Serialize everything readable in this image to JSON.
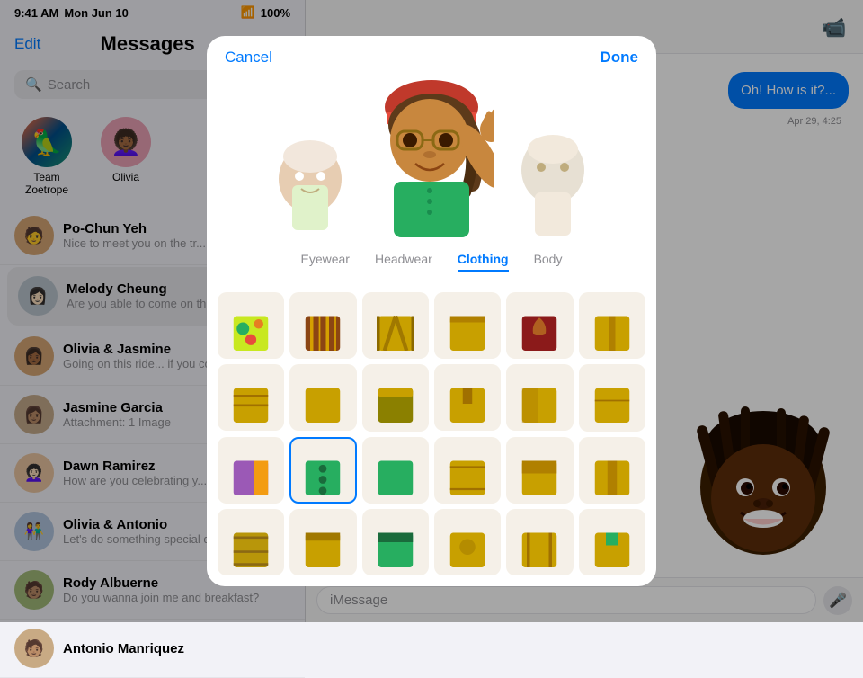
{
  "statusBar": {
    "time": "9:41 AM",
    "date": "Mon Jun 10",
    "wifi": "WiFi",
    "battery": "100%"
  },
  "sidebar": {
    "title": "Messages",
    "editLabel": "Edit",
    "searchPlaceholder": "Search",
    "pinnedItems": [
      {
        "id": "team-zoetrope",
        "label": "Team Zoetrope",
        "emoji": "🦜"
      },
      {
        "id": "olivia",
        "label": "Olivia",
        "emoji": "👩🏾‍🦱"
      }
    ],
    "conversations": [
      {
        "id": "po-chun",
        "name": "Po-Chun Yeh",
        "preview": "Nice to meet you on the tr...",
        "emoji": "🧑"
      },
      {
        "id": "melody",
        "name": "Melody Cheung",
        "preview": "Are you able to come on th ride or not?",
        "emoji": "👩🏻",
        "active": true
      },
      {
        "id": "olivia-jasmine",
        "name": "Olivia & Jasmine",
        "preview": "Going on this ride... if you come too you're welcome",
        "emoji": "👩🏾"
      },
      {
        "id": "jasmine-garcia",
        "name": "Jasmine Garcia",
        "preview": "Attachment: 1 Image",
        "emoji": "👩🏽"
      },
      {
        "id": "dawn-ramirez",
        "name": "Dawn Ramirez",
        "preview": "How are you celebrating y... big day?",
        "emoji": "👩🏻‍🦱"
      },
      {
        "id": "olivia-antonio",
        "name": "Olivia & Antonio",
        "preview": "Let's do something special dawn at the next meeting r...",
        "emoji": "👫"
      },
      {
        "id": "rody-albuerne",
        "name": "Rody Albuerne",
        "preview": "Do you wanna join me and breakfast?",
        "emoji": "🧑🏽"
      },
      {
        "id": "antonio-manriquez",
        "name": "Antonio Manriquez",
        "preview": "",
        "emoji": "🧑🏽"
      }
    ]
  },
  "chat": {
    "bubbles": [
      {
        "text": "Oh! How is it?..."
      },
      {
        "text": "Apr 29, 4:25"
      }
    ],
    "inputPlaceholder": "iMessage"
  },
  "modal": {
    "cancelLabel": "Cancel",
    "doneLabel": "Done",
    "categories": [
      {
        "id": "eyewear",
        "label": "Eyewear",
        "active": false
      },
      {
        "id": "headwear",
        "label": "Headwear",
        "active": false
      },
      {
        "id": "clothing",
        "label": "Clothing",
        "active": true
      },
      {
        "id": "body",
        "label": "Body",
        "active": false
      }
    ],
    "clothingItems": [
      {
        "id": 1,
        "color1": "#2ecc71",
        "color2": "#f39c12",
        "pattern": "circles",
        "selected": false
      },
      {
        "id": 2,
        "color1": "#8B4513",
        "color2": "#c17f24",
        "pattern": "stripes",
        "selected": false
      },
      {
        "id": 3,
        "color1": "#c8a000",
        "color2": "#a07800",
        "pattern": "vstripes",
        "selected": false
      },
      {
        "id": 4,
        "color1": "#c8a000",
        "color2": "#b89000",
        "pattern": "plain",
        "selected": false
      },
      {
        "id": 5,
        "color1": "#8B0000",
        "color2": "#c17f24",
        "pattern": "embroidery",
        "selected": false
      },
      {
        "id": 6,
        "color1": "#c8a000",
        "color2": "#a07800",
        "pattern": "plain2",
        "selected": false
      },
      {
        "id": 7,
        "color1": "#c8a000",
        "color2": "#b08000",
        "pattern": "lines",
        "selected": false
      },
      {
        "id": 8,
        "color1": "#c8a000",
        "color2": "#b08000",
        "pattern": "plain3",
        "selected": false
      },
      {
        "id": 9,
        "color1": "#8B8000",
        "color2": "#c8a000",
        "pattern": "collar",
        "selected": false
      },
      {
        "id": 10,
        "color1": "#c8a000",
        "color2": "#a07800",
        "pattern": "plain4",
        "selected": false
      },
      {
        "id": 11,
        "color1": "#c8a000",
        "color2": "#a07800",
        "pattern": "plain5",
        "selected": false
      },
      {
        "id": 12,
        "color1": "#c8a000",
        "color2": "#a07800",
        "pattern": "plain6",
        "selected": false
      },
      {
        "id": 13,
        "color1": "#9B59B6",
        "color2": "#f39c12",
        "pattern": "sari",
        "selected": false
      },
      {
        "id": 14,
        "color1": "#27ae60",
        "color2": "#1a6b3c",
        "pattern": "green-shirt",
        "selected": true
      },
      {
        "id": 15,
        "color1": "#27ae60",
        "color2": "#1a6b3c",
        "pattern": "green-plain",
        "selected": false
      },
      {
        "id": 16,
        "color1": "#c8a000",
        "color2": "#a07800",
        "pattern": "yellow7",
        "selected": false
      },
      {
        "id": 17,
        "color1": "#c8a000",
        "color2": "#a07800",
        "pattern": "yellow8",
        "selected": false
      },
      {
        "id": 18,
        "color1": "#c8a000",
        "color2": "#a07800",
        "pattern": "yellow9",
        "selected": false
      },
      {
        "id": 19,
        "color1": "#b8960a",
        "color2": "#8B6914",
        "pattern": "yellow10",
        "selected": false
      },
      {
        "id": 20,
        "color1": "#c8a000",
        "color2": "#a07800",
        "pattern": "yellow11",
        "selected": false
      },
      {
        "id": 21,
        "color1": "#27ae60",
        "color2": "#1a6b3c",
        "pattern": "green2",
        "selected": false
      },
      {
        "id": 22,
        "color1": "#c8a000",
        "color2": "#a07800",
        "pattern": "yellow12",
        "selected": false
      },
      {
        "id": 23,
        "color1": "#c8a000",
        "color2": "#a07800",
        "pattern": "yellow13",
        "selected": false
      },
      {
        "id": 24,
        "color1": "#c8a000",
        "color2": "#a07800",
        "pattern": "yellow14",
        "selected": false
      }
    ]
  }
}
